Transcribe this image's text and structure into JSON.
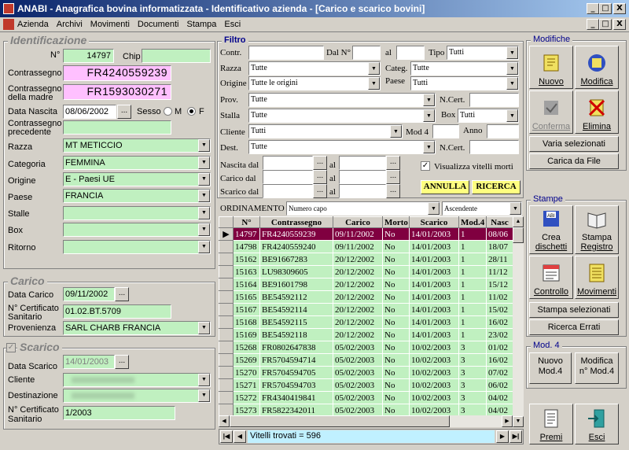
{
  "window": {
    "title": "ANABI - Anagrafica bovina informatizzata - Identificativo azienda - [Carico e scarico bovini]",
    "min": "_",
    "max": "□",
    "close": "X"
  },
  "menu": [
    "Azienda",
    "Archivi",
    "Movimenti",
    "Documenti",
    "Stampa",
    "Esci"
  ],
  "identificazione": {
    "title": "Identificazione",
    "n_label": "N°",
    "n_value": "14797",
    "chip_label": "Chip",
    "chip_value": "",
    "contrassegno_label": "Contrassegno",
    "contrassegno_value": "FR4240559239",
    "contr_madre_label1": "Contrassegno",
    "contr_madre_label2": "della madre",
    "contr_madre_value": "FR1593030271",
    "data_nascita_label": "Data Nascita",
    "data_nascita_value": "08/06/2002",
    "sesso_label": "Sesso",
    "sesso_m": "M",
    "sesso_f": "F",
    "contr_prec_label1": "Contrassegno",
    "contr_prec_label2": "precedente",
    "contr_prec_value": "",
    "razza_label": "Razza",
    "razza_value": "MT METICCIO",
    "categoria_label": "Categoria",
    "categoria_value": "FEMMINA",
    "origine_label": "Origine",
    "origine_value": "E - Paesi UE",
    "paese_label": "Paese",
    "paese_value": "FRANCIA",
    "stalle_label": "Stalle",
    "box_label": "Box",
    "ritorno_label": "Ritorno"
  },
  "carico": {
    "title": "Carico",
    "data_label": "Data Carico",
    "data_value": "09/11/2002",
    "cert_label1": "N° Certificato",
    "cert_label2": "Sanitario",
    "cert_value": "01.02.BT.5709",
    "prov_label": "Provenienza",
    "prov_value": "SARL CHARB FRANCIA"
  },
  "scarico": {
    "title": "Scarico",
    "data_label": "Data Scarico",
    "data_value": "14/01/2003",
    "cliente_label": "Cliente",
    "dest_label": "Destinazione",
    "cert_label1": "N° Certificato",
    "cert_label2": "Sanitario",
    "cert_value": "1/2003"
  },
  "filtro": {
    "title": "Filtro",
    "contr": "Contr.",
    "dal_n": "Dal N°",
    "al": "al",
    "tipo": "Tipo",
    "tipo_value": "Tutti",
    "razza": "Razza",
    "razza_value": "Tutte",
    "categ": "Categ.",
    "categ_value": "Tutte",
    "origine": "Origine",
    "origine_value": "Tutte le origini",
    "paese": "Paese",
    "paese_value": "Tutti",
    "prov": "Prov.",
    "prov_value": "Tutte",
    "ncert": "N.Cert.",
    "stalla": "Stalla",
    "stalla_value": "Tutte",
    "box": "Box",
    "box_value": "Tutti",
    "cliente": "Cliente",
    "cliente_value": "Tutti",
    "mod4": "Mod 4",
    "anno": "Anno",
    "dest": "Dest.",
    "dest_value": "Tutte",
    "ncert2": "N.Cert.",
    "nascita_dal": "Nascita dal",
    "carico_dal": "Carico dal",
    "scarico_dal": "Scarico dal",
    "visualizza": "Visualizza vitelli morti",
    "annulla": "ANNULLA",
    "ricerca": "RICERCA"
  },
  "ordinamento": {
    "label": "ORDINAMENTO",
    "value": "Numero capo",
    "dir": "Ascendente"
  },
  "table": {
    "headers": [
      "N°",
      "Contrassegno",
      "Carico",
      "Morto",
      "Scarico",
      "Mod.4",
      "Nasc"
    ],
    "rows": [
      [
        "14797",
        "FR4240559239",
        "09/11/2002",
        "No",
        "14/01/2003",
        "1",
        "08/06"
      ],
      [
        "14798",
        "FR4240559240",
        "09/11/2002",
        "No",
        "14/01/2003",
        "1",
        "18/07"
      ],
      [
        "15162",
        "BE91667283",
        "20/12/2002",
        "No",
        "14/01/2003",
        "1",
        "28/11"
      ],
      [
        "15163",
        "LU98309605",
        "20/12/2002",
        "No",
        "14/01/2003",
        "1",
        "11/12"
      ],
      [
        "15164",
        "BE91601798",
        "20/12/2002",
        "No",
        "14/01/2003",
        "1",
        "15/12"
      ],
      [
        "15165",
        "BE54592112",
        "20/12/2002",
        "No",
        "14/01/2003",
        "1",
        "11/02"
      ],
      [
        "15167",
        "BE54592114",
        "20/12/2002",
        "No",
        "14/01/2003",
        "1",
        "15/02"
      ],
      [
        "15168",
        "BE54592115",
        "20/12/2002",
        "No",
        "14/01/2003",
        "1",
        "16/02"
      ],
      [
        "15169",
        "BE54592118",
        "20/12/2002",
        "No",
        "14/01/2003",
        "1",
        "23/02"
      ],
      [
        "15268",
        "FR0802647838",
        "05/02/2003",
        "No",
        "10/02/2003",
        "3",
        "01/02"
      ],
      [
        "15269",
        "FR5704594714",
        "05/02/2003",
        "No",
        "10/02/2003",
        "3",
        "16/02"
      ],
      [
        "15270",
        "FR5704594705",
        "05/02/2003",
        "No",
        "10/02/2003",
        "3",
        "07/02"
      ],
      [
        "15271",
        "FR5704594703",
        "05/02/2003",
        "No",
        "10/02/2003",
        "3",
        "06/02"
      ],
      [
        "15272",
        "FR4340419841",
        "05/02/2003",
        "No",
        "10/02/2003",
        "3",
        "04/02"
      ],
      [
        "15273",
        "FR5822342011",
        "05/02/2003",
        "No",
        "10/02/2003",
        "3",
        "04/02"
      ]
    ]
  },
  "status": "Vitelli trovati = 596",
  "modifiche": {
    "title": "Modifiche",
    "nuovo": "Nuovo",
    "modifica": "Modifica",
    "conferma": "Conferma",
    "elimina": "Elimina",
    "varia": "Varia selezionati",
    "carica": "Carica da File"
  },
  "stampe": {
    "title": "Stampe",
    "crea1": "Crea",
    "crea2": "dischetti",
    "stampa1": "Stampa",
    "stampa2": "Registro",
    "controllo": "Controllo",
    "movimenti": "Movimenti",
    "stampa_sel": "Stampa selezionati",
    "ricerca_errati": "Ricerca Errati"
  },
  "mod4": {
    "title": "Mod. 4",
    "nuovo1": "Nuovo",
    "nuovo2": "Mod.4",
    "modifica1": "Modifica",
    "modifica2": "n° Mod.4"
  },
  "bottom": {
    "premi": "Premi",
    "esci": "Esci"
  }
}
